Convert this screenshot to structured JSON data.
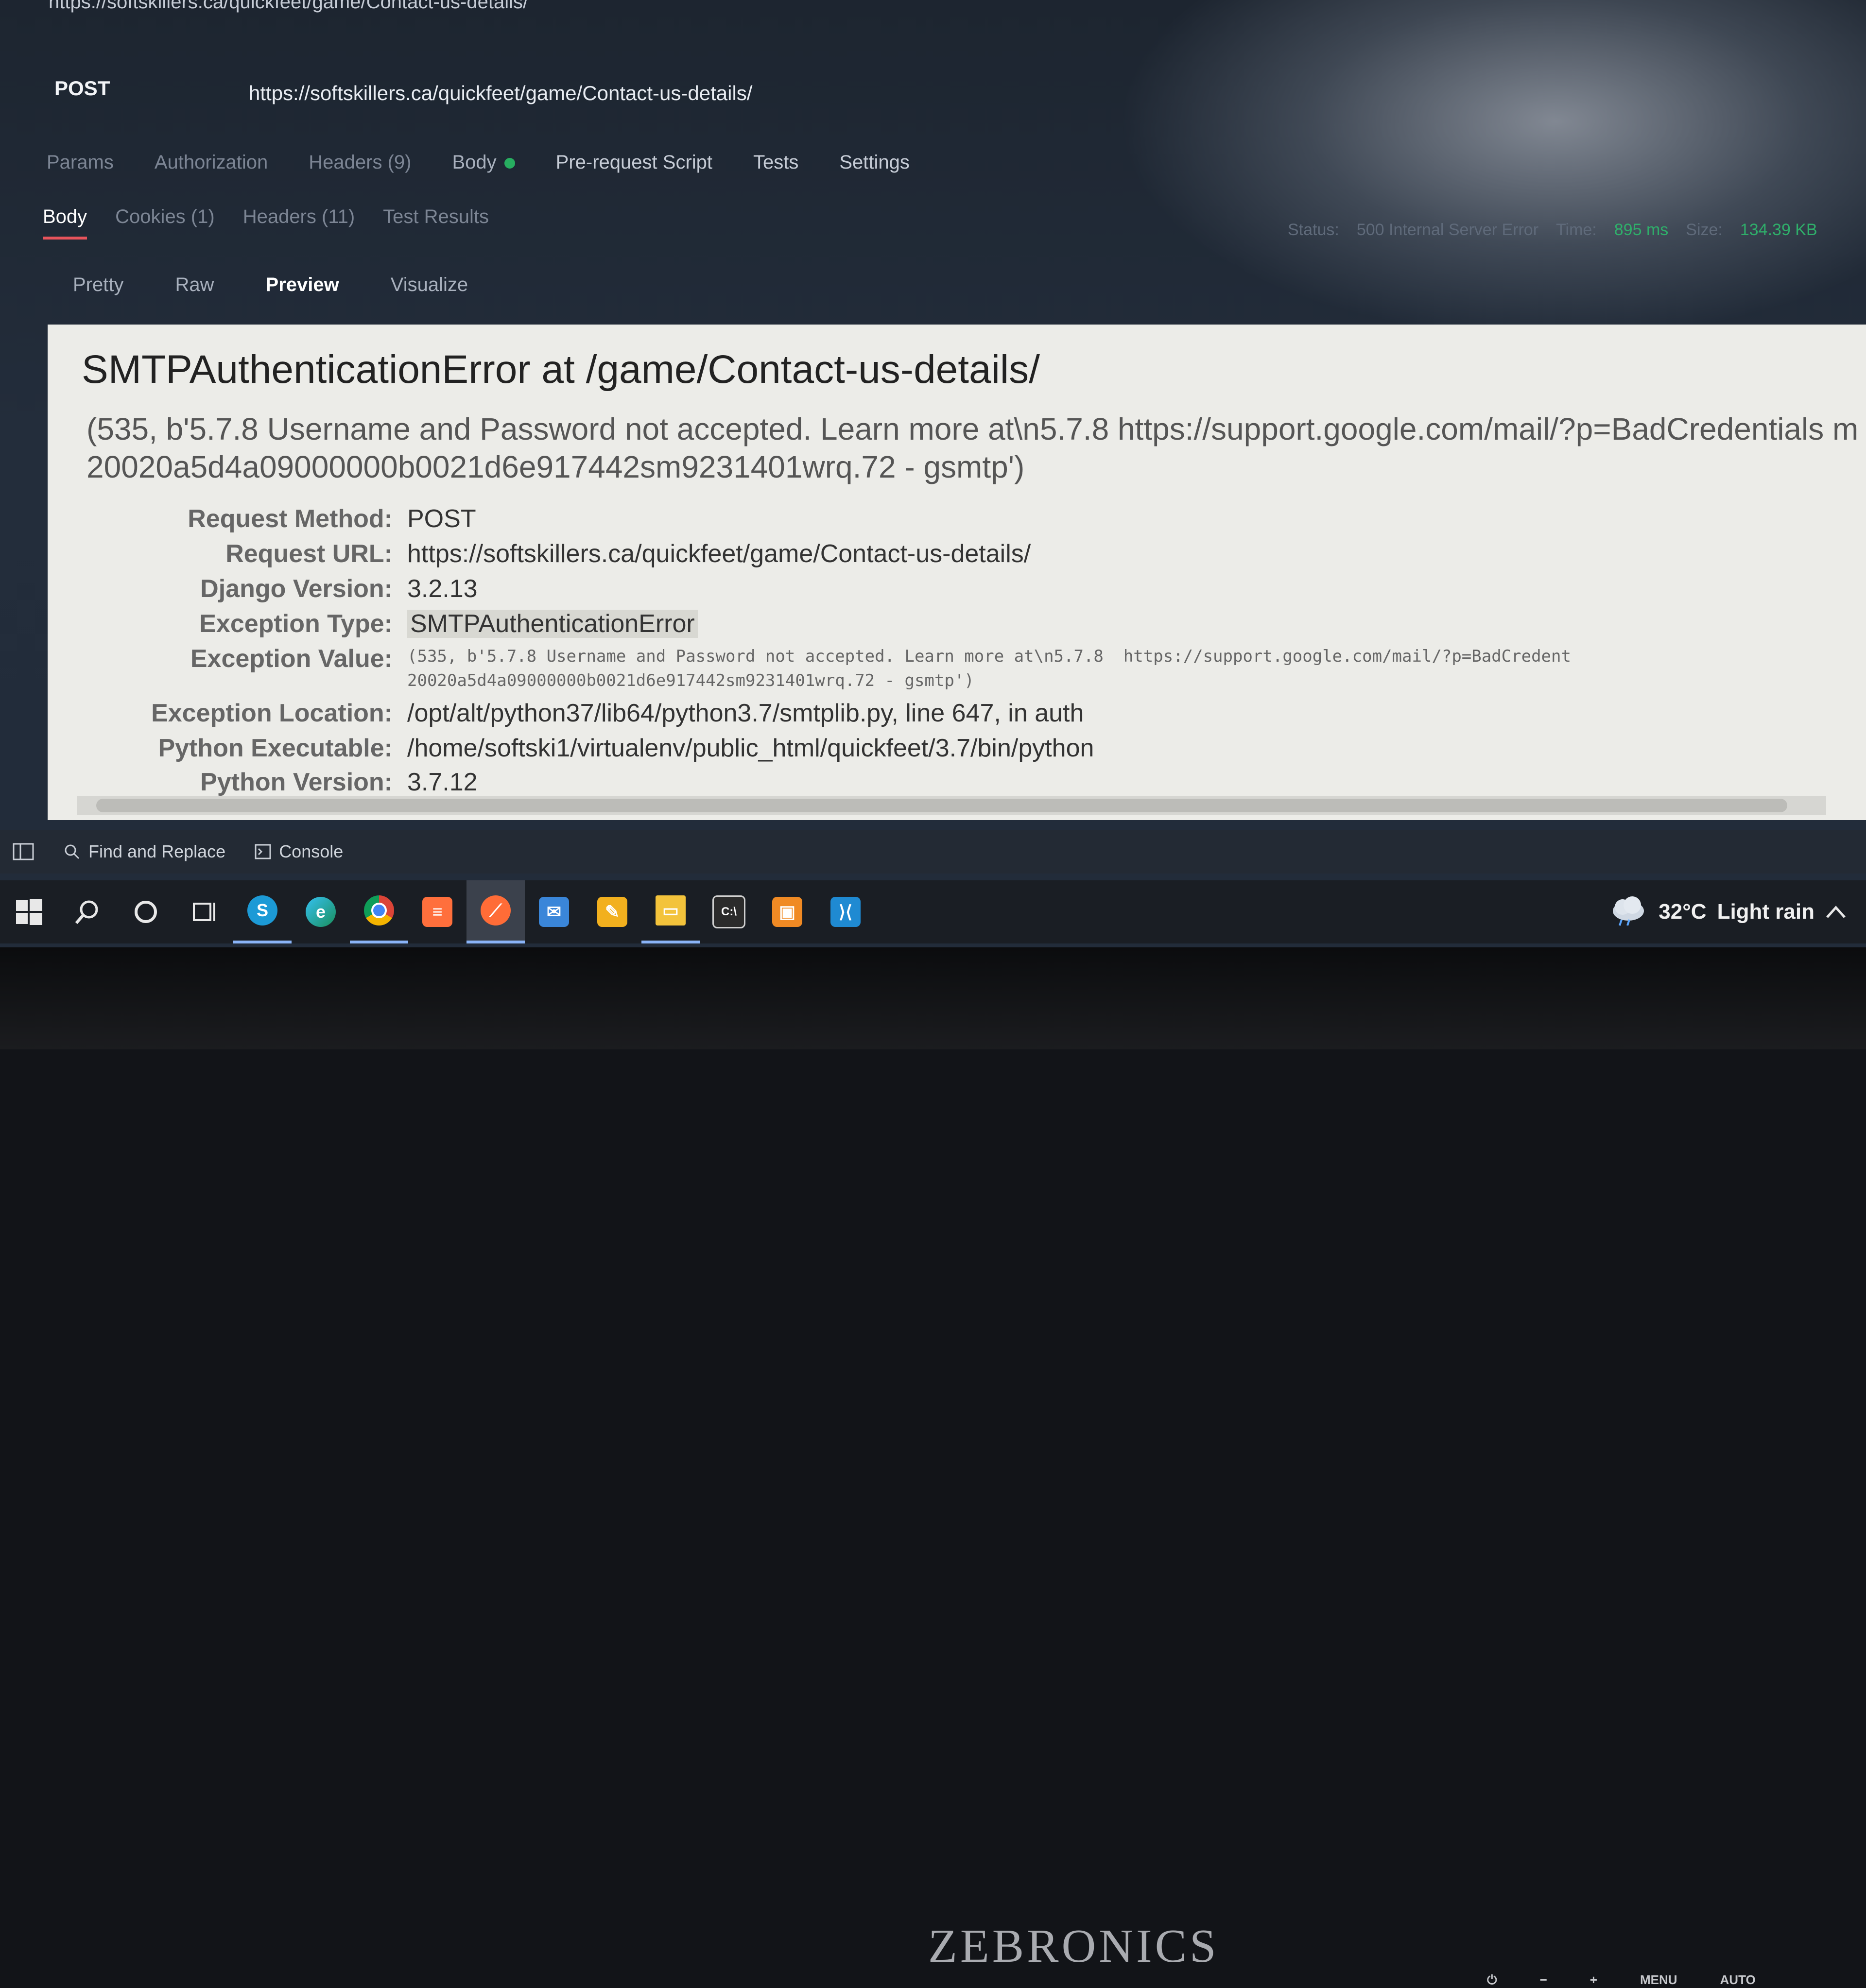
{
  "top_url": "https://softskillers.ca/quickfeet/game/Contact-us-details/",
  "request": {
    "method": "POST",
    "url": "https://softskillers.ca/quickfeet/game/Contact-us-details/"
  },
  "request_tabs": [
    "Params",
    "Authorization",
    "Headers (9)",
    "Body",
    "Pre-request Script",
    "Tests",
    "Settings"
  ],
  "response_tabs": [
    "Body",
    "Cookies (1)",
    "Headers (11)",
    "Test Results"
  ],
  "status": {
    "label_status": "Status:",
    "status_value": "500 Internal Server Error",
    "label_time": "Time:",
    "time_value": "895 ms",
    "label_size": "Size:",
    "size_value": "134.39 KB"
  },
  "view_tabs": [
    "Pretty",
    "Raw",
    "Preview",
    "Visualize"
  ],
  "preview": {
    "title": "SMTPAuthenticationError at /game/Contact-us-details/",
    "message_line1": "(535, b'5.7.8 Username and Password not accepted. Learn more at\\n5.7.8  https://support.google.com/mail/?p=BadCredentials m",
    "message_line2": "20020a5d4a09000000b0021d6e917442sm9231401wrq.72 - gsmtp')",
    "rows": [
      {
        "key": "Request Method:",
        "value": "POST"
      },
      {
        "key": "Request URL:",
        "value": "https://softskillers.ca/quickfeet/game/Contact-us-details/"
      },
      {
        "key": "Django Version:",
        "value": "3.2.13"
      },
      {
        "key": "Exception Type:",
        "value": "SMTPAuthenticationError"
      },
      {
        "key": "Exception Value:",
        "value": "(535, b'5.7.8 Username and Password not accepted. Learn more at\\n5.7.8  https://support.google.com/mail/?p=BadCredent",
        "value2": "20020a5d4a09000000b0021d6e917442sm9231401wrq.72 - gsmtp')"
      },
      {
        "key": "Exception Location:",
        "value": "/opt/alt/python37/lib64/python3.7/smtplib.py, line 647, in auth"
      },
      {
        "key": "Python Executable:",
        "value": "/home/softski1/virtualenv/public_html/quickfeet/3.7/bin/python"
      },
      {
        "key": "Python Version:",
        "value": "3.7.12"
      }
    ]
  },
  "bottom_bar": {
    "find_replace": "Find and Replace",
    "console": "Console"
  },
  "weather": {
    "temp": "32°C",
    "desc": "Light rain"
  },
  "monitor": {
    "brand": "ZEBRONICS",
    "menu": "MENU",
    "auto": "AUTO",
    "minus": "−",
    "plus": "+"
  },
  "colors": {
    "accent_tab": "#e8545c",
    "status_green": "#2fae6a",
    "body_dot": "#27ae60"
  }
}
